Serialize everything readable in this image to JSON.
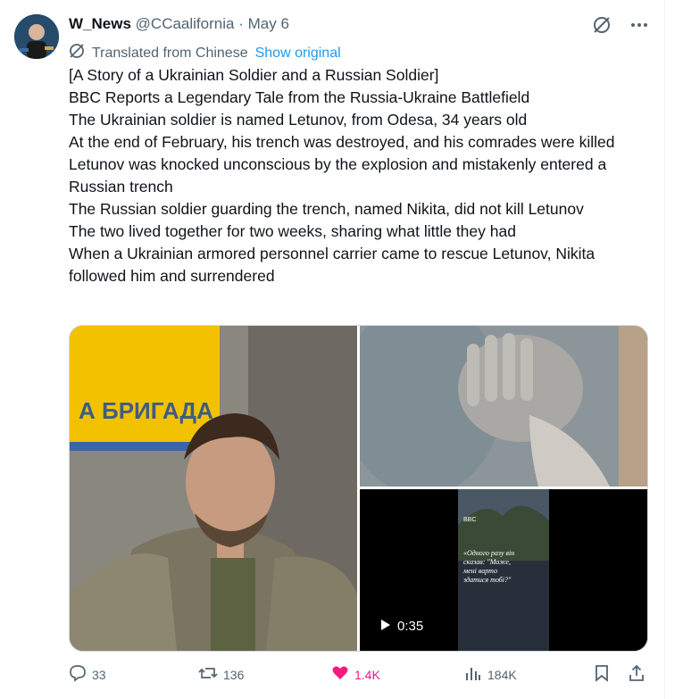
{
  "tweet": {
    "author_name": "W_News",
    "handle": "@CCaalifornia",
    "separator": "·",
    "date": "May 6",
    "translated_label": "Translated from Chinese",
    "show_original": "Show original",
    "lines": [
      "[A Story of a Ukrainian Soldier and a Russian Soldier]",
      "BBC Reports a Legendary Tale from the Russia-Ukraine Battlefield",
      "The Ukrainian soldier is named Letunov, from Odesa, 34 years old",
      "At the end of February, his trench was destroyed, and his comrades were killed",
      "Letunov was knocked unconscious by the explosion and mistakenly entered a Russian trench",
      "The Russian soldier guarding the trench, named Nikita, did not kill Letunov",
      "The two lived together for two weeks, sharing what little they had",
      "When a Ukrainian armored personnel carrier came to rescue Letunov, Nikita followed him and surrendered"
    ]
  },
  "media": {
    "banner_text": "А БРИГАДА",
    "video_logo": "BBC",
    "video_caption": "\"Одного разу він сказав: 'Може, мені варто здатися тобі?'\"",
    "video_duration": "0:35"
  },
  "actions": {
    "replies": "33",
    "reposts": "136",
    "likes": "1.4K",
    "views": "184K"
  },
  "colors": {
    "accent": "#1d9bf0",
    "like": "#f91880",
    "muted": "#536471"
  }
}
